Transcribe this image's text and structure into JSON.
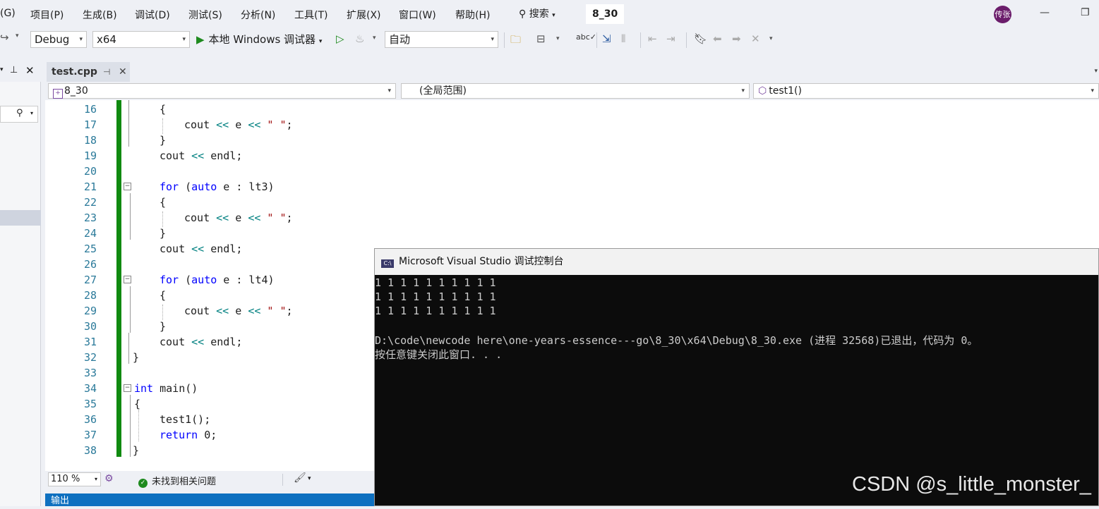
{
  "menu": {
    "items": [
      "(G)",
      "项目(P)",
      "生成(B)",
      "调试(D)",
      "测试(S)",
      "分析(N)",
      "工具(T)",
      "扩展(X)",
      "窗口(W)",
      "帮助(H)"
    ],
    "search": "搜索",
    "solution": "8_30",
    "avatar": "传张"
  },
  "toolbar": {
    "config": "Debug",
    "platform": "x64",
    "run_label": "本地 Windows 调试器",
    "mode": "自动"
  },
  "tab": {
    "label": "test.cpp"
  },
  "navbar": {
    "project": "8_30",
    "scope": "(全局范围)",
    "member": "test1()"
  },
  "editor": {
    "line_numbers": [
      "16",
      "17",
      "18",
      "19",
      "20",
      "21",
      "22",
      "23",
      "24",
      "25",
      "26",
      "27",
      "28",
      "29",
      "30",
      "31",
      "32",
      "33",
      "34",
      "35",
      "36",
      "37",
      "38"
    ]
  },
  "status": {
    "zoom": "110 %",
    "issues": "未找到相关问题",
    "output": "输出"
  },
  "console": {
    "title": "Microsoft Visual Studio 调试控制台",
    "lines": [
      "1 1 1 1 1 1 1 1 1 1",
      "1 1 1 1 1 1 1 1 1 1",
      "1 1 1 1 1 1 1 1 1 1",
      "",
      "D:\\code\\newcode here\\one-years-essence---go\\8_30\\x64\\Debug\\8_30.exe (进程 32568)已退出，代码为 0。",
      "按任意键关闭此窗口. . ."
    ]
  },
  "watermark": "CSDN @s_little_monster_"
}
